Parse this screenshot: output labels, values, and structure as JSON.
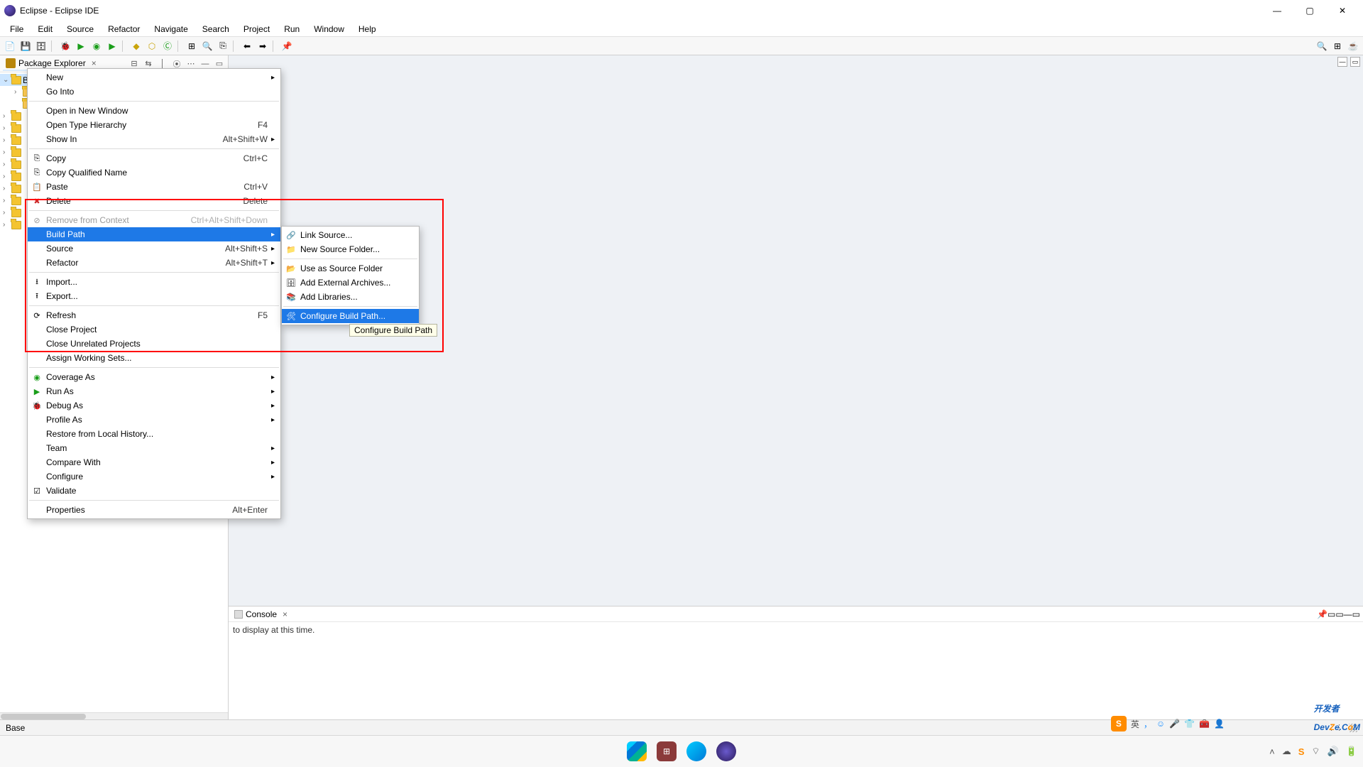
{
  "window": {
    "title": "Eclipse - Eclipse IDE"
  },
  "menubar": [
    "File",
    "Edit",
    "Source",
    "Refactor",
    "Navigate",
    "Search",
    "Project",
    "Run",
    "Window",
    "Help"
  ],
  "package_explorer": {
    "title": "Package Explorer",
    "projects": [
      "Base"
    ]
  },
  "context_menu": {
    "items": [
      {
        "label": "New",
        "shortcut": "",
        "arrow": true
      },
      {
        "label": "Go Into"
      },
      {
        "sep": true
      },
      {
        "label": "Open in New Window"
      },
      {
        "label": "Open Type Hierarchy",
        "shortcut": "F4"
      },
      {
        "label": "Show In",
        "shortcut": "Alt+Shift+W",
        "arrow": true
      },
      {
        "sep": true
      },
      {
        "label": "Copy",
        "shortcut": "Ctrl+C",
        "icon": "copy"
      },
      {
        "label": "Copy Qualified Name",
        "icon": "copy"
      },
      {
        "label": "Paste",
        "shortcut": "Ctrl+V",
        "icon": "paste"
      },
      {
        "label": "Delete",
        "shortcut": "Delete",
        "icon": "delete"
      },
      {
        "sep": true
      },
      {
        "label": "Remove from Context",
        "shortcut": "Ctrl+Alt+Shift+Down",
        "icon": "remove",
        "disabled": true
      },
      {
        "label": "Build Path",
        "arrow": true,
        "highlight": true
      },
      {
        "label": "Source",
        "shortcut": "Alt+Shift+S",
        "arrow": true
      },
      {
        "label": "Refactor",
        "shortcut": "Alt+Shift+T",
        "arrow": true
      },
      {
        "sep": true
      },
      {
        "label": "Import...",
        "icon": "import"
      },
      {
        "label": "Export...",
        "icon": "export"
      },
      {
        "sep": true
      },
      {
        "label": "Refresh",
        "shortcut": "F5",
        "icon": "refresh"
      },
      {
        "label": "Close Project"
      },
      {
        "label": "Close Unrelated Projects"
      },
      {
        "label": "Assign Working Sets..."
      },
      {
        "sep": true
      },
      {
        "label": "Coverage As",
        "arrow": true,
        "icon": "coverage"
      },
      {
        "label": "Run As",
        "arrow": true,
        "icon": "run"
      },
      {
        "label": "Debug As",
        "arrow": true,
        "icon": "debug"
      },
      {
        "label": "Profile As",
        "arrow": true
      },
      {
        "label": "Restore from Local History..."
      },
      {
        "label": "Team",
        "arrow": true
      },
      {
        "label": "Compare With",
        "arrow": true
      },
      {
        "label": "Configure",
        "arrow": true
      },
      {
        "label": "Validate",
        "icon": "check"
      },
      {
        "sep": true
      },
      {
        "label": "Properties",
        "shortcut": "Alt+Enter"
      }
    ]
  },
  "submenu": {
    "items": [
      {
        "label": "Link Source...",
        "icon": "link"
      },
      {
        "label": "New Source Folder...",
        "icon": "folder"
      },
      {
        "sep": true
      },
      {
        "label": "Use as Source Folder",
        "icon": "srcfolder"
      },
      {
        "label": "Add External Archives...",
        "icon": "archive"
      },
      {
        "label": "Add Libraries...",
        "icon": "lib"
      },
      {
        "sep": true
      },
      {
        "label": "Configure Build Path...",
        "icon": "config",
        "highlight": true
      }
    ]
  },
  "tooltip": "Configure Build Path",
  "console": {
    "title": "Console",
    "message": "to display at this time."
  },
  "statusbar": {
    "left": "Base"
  },
  "watermark": {
    "text1": "开发者",
    "text2": "DevZe.CoM"
  },
  "ime_indicator": "英"
}
